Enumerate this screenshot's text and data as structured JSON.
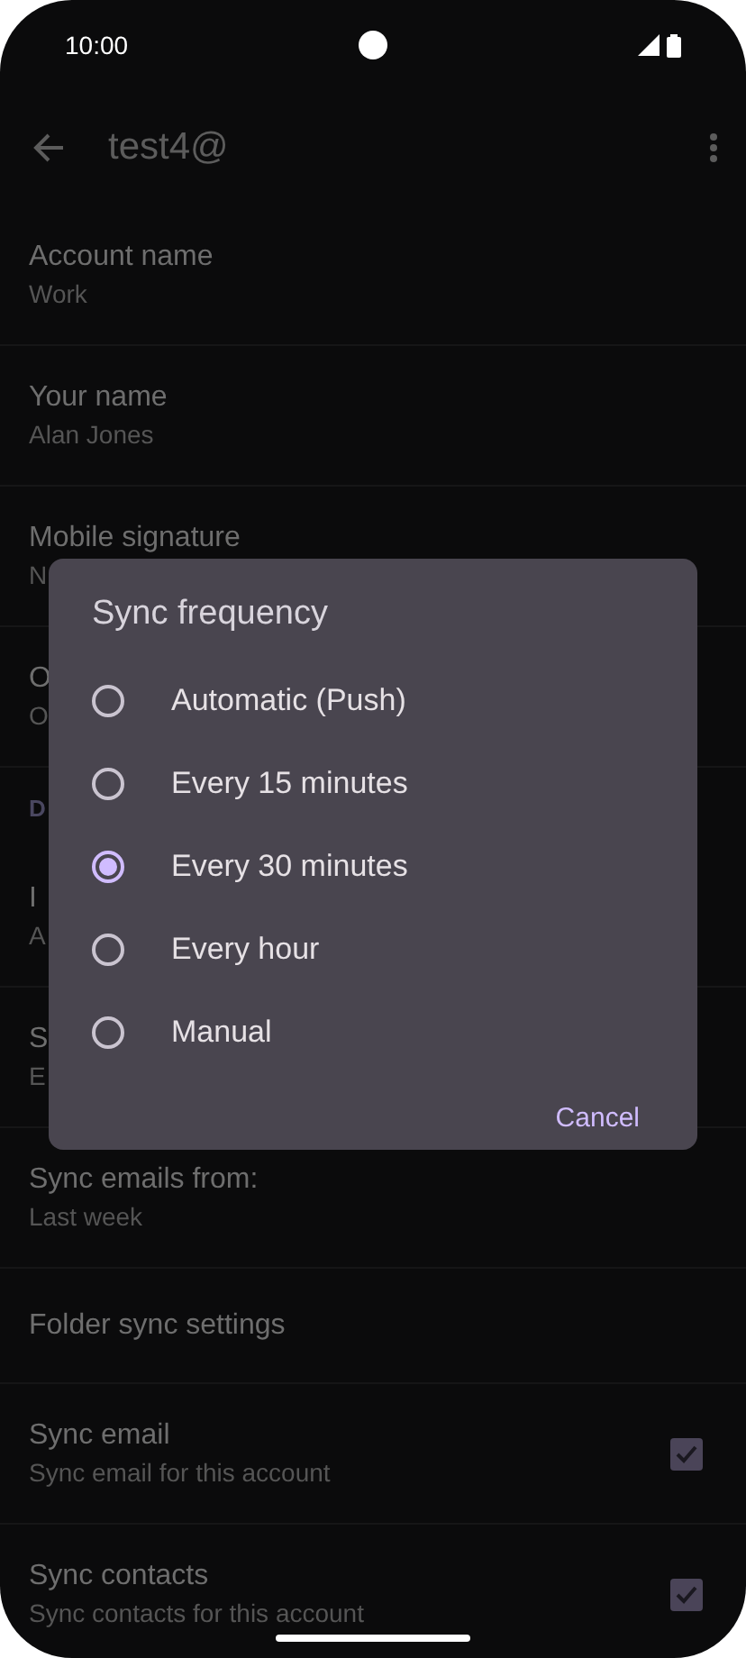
{
  "status_bar": {
    "time": "10:00"
  },
  "app_bar": {
    "title": "test4@"
  },
  "settings": [
    {
      "kind": "item",
      "title": "Account name",
      "subtitle": "Work"
    },
    {
      "kind": "item",
      "title": "Your name",
      "subtitle": "Alan Jones"
    },
    {
      "kind": "item",
      "title": "Mobile signature",
      "subtitle": "N"
    },
    {
      "kind": "item",
      "title": "O",
      "subtitle": "O"
    },
    {
      "kind": "header",
      "title": "D"
    },
    {
      "kind": "item",
      "title": "I",
      "subtitle": "A"
    },
    {
      "kind": "item",
      "title": "S",
      "subtitle": "E"
    },
    {
      "kind": "item",
      "title": "Sync emails from:",
      "subtitle": "Last week"
    },
    {
      "kind": "item",
      "title": "Folder sync settings"
    },
    {
      "kind": "check",
      "title": "Sync email",
      "subtitle": "Sync email for this account",
      "checked": true
    },
    {
      "kind": "check",
      "title": "Sync contacts",
      "subtitle": "Sync contacts for this account",
      "checked": true
    }
  ],
  "dialog": {
    "title": "Sync frequency",
    "options": [
      {
        "label": "Automatic (Push)",
        "selected": false
      },
      {
        "label": "Every 15 minutes",
        "selected": false
      },
      {
        "label": "Every 30 minutes",
        "selected": true
      },
      {
        "label": "Every hour",
        "selected": false
      },
      {
        "label": "Manual",
        "selected": false
      }
    ],
    "button": "Cancel"
  }
}
